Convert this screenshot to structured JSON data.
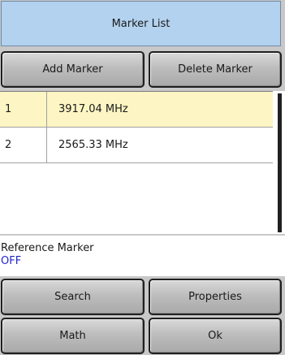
{
  "dialog": {
    "title": "Marker List"
  },
  "toolbar": {
    "add_label": "Add Marker",
    "delete_label": "Delete Marker"
  },
  "markers": [
    {
      "index": "1",
      "frequency": "3917.04 MHz",
      "selected": true
    },
    {
      "index": "2",
      "frequency": "2565.33 MHz",
      "selected": false
    }
  ],
  "reference": {
    "label": "Reference Marker",
    "value": "OFF"
  },
  "actions": {
    "search_label": "Search",
    "properties_label": "Properties",
    "math_label": "Math",
    "ok_label": "Ok"
  },
  "colors": {
    "title_bg": "#b3d2ef",
    "selected_row": "#fdf5c3",
    "ref_value": "#2323c8"
  }
}
